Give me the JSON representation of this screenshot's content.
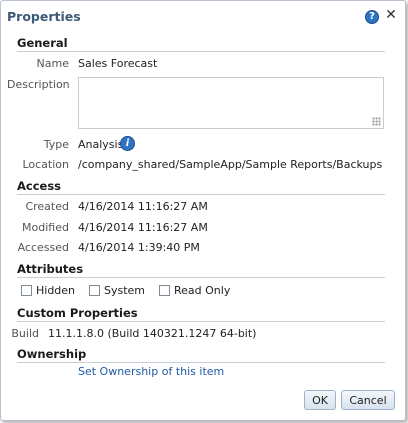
{
  "dialog": {
    "title": "Properties"
  },
  "icons": {
    "help": "help-icon",
    "close": "close-icon",
    "info": "info-icon"
  },
  "general": {
    "heading": "General",
    "name_label": "Name",
    "name_value": "Sales Forecast",
    "description_label": "Description",
    "description_value": "",
    "type_label": "Type",
    "type_value": "Analysis",
    "location_label": "Location",
    "location_value": "/company_shared/SampleApp/Sample Reports/Backups"
  },
  "access": {
    "heading": "Access",
    "created_label": "Created",
    "created_value": "4/16/2014 11:16:27 AM",
    "modified_label": "Modified",
    "modified_value": "4/16/2014 11:16:27 AM",
    "accessed_label": "Accessed",
    "accessed_value": "4/16/2014 1:39:40 PM"
  },
  "attributes": {
    "heading": "Attributes",
    "hidden": {
      "label": "Hidden",
      "checked": false
    },
    "system": {
      "label": "System",
      "checked": false
    },
    "read_only": {
      "label": "Read Only",
      "checked": false
    }
  },
  "custom": {
    "heading": "Custom Properties",
    "build_label": "Build",
    "build_value": "11.1.1.8.0 (Build 140321.1247 64-bit)"
  },
  "ownership": {
    "heading": "Ownership",
    "link": "Set Ownership of this item"
  },
  "buttons": {
    "ok": "OK",
    "cancel": "Cancel"
  },
  "colors": {
    "title": "#3c5a78",
    "link": "#1f5aa6",
    "icon": "#2f73c4"
  }
}
